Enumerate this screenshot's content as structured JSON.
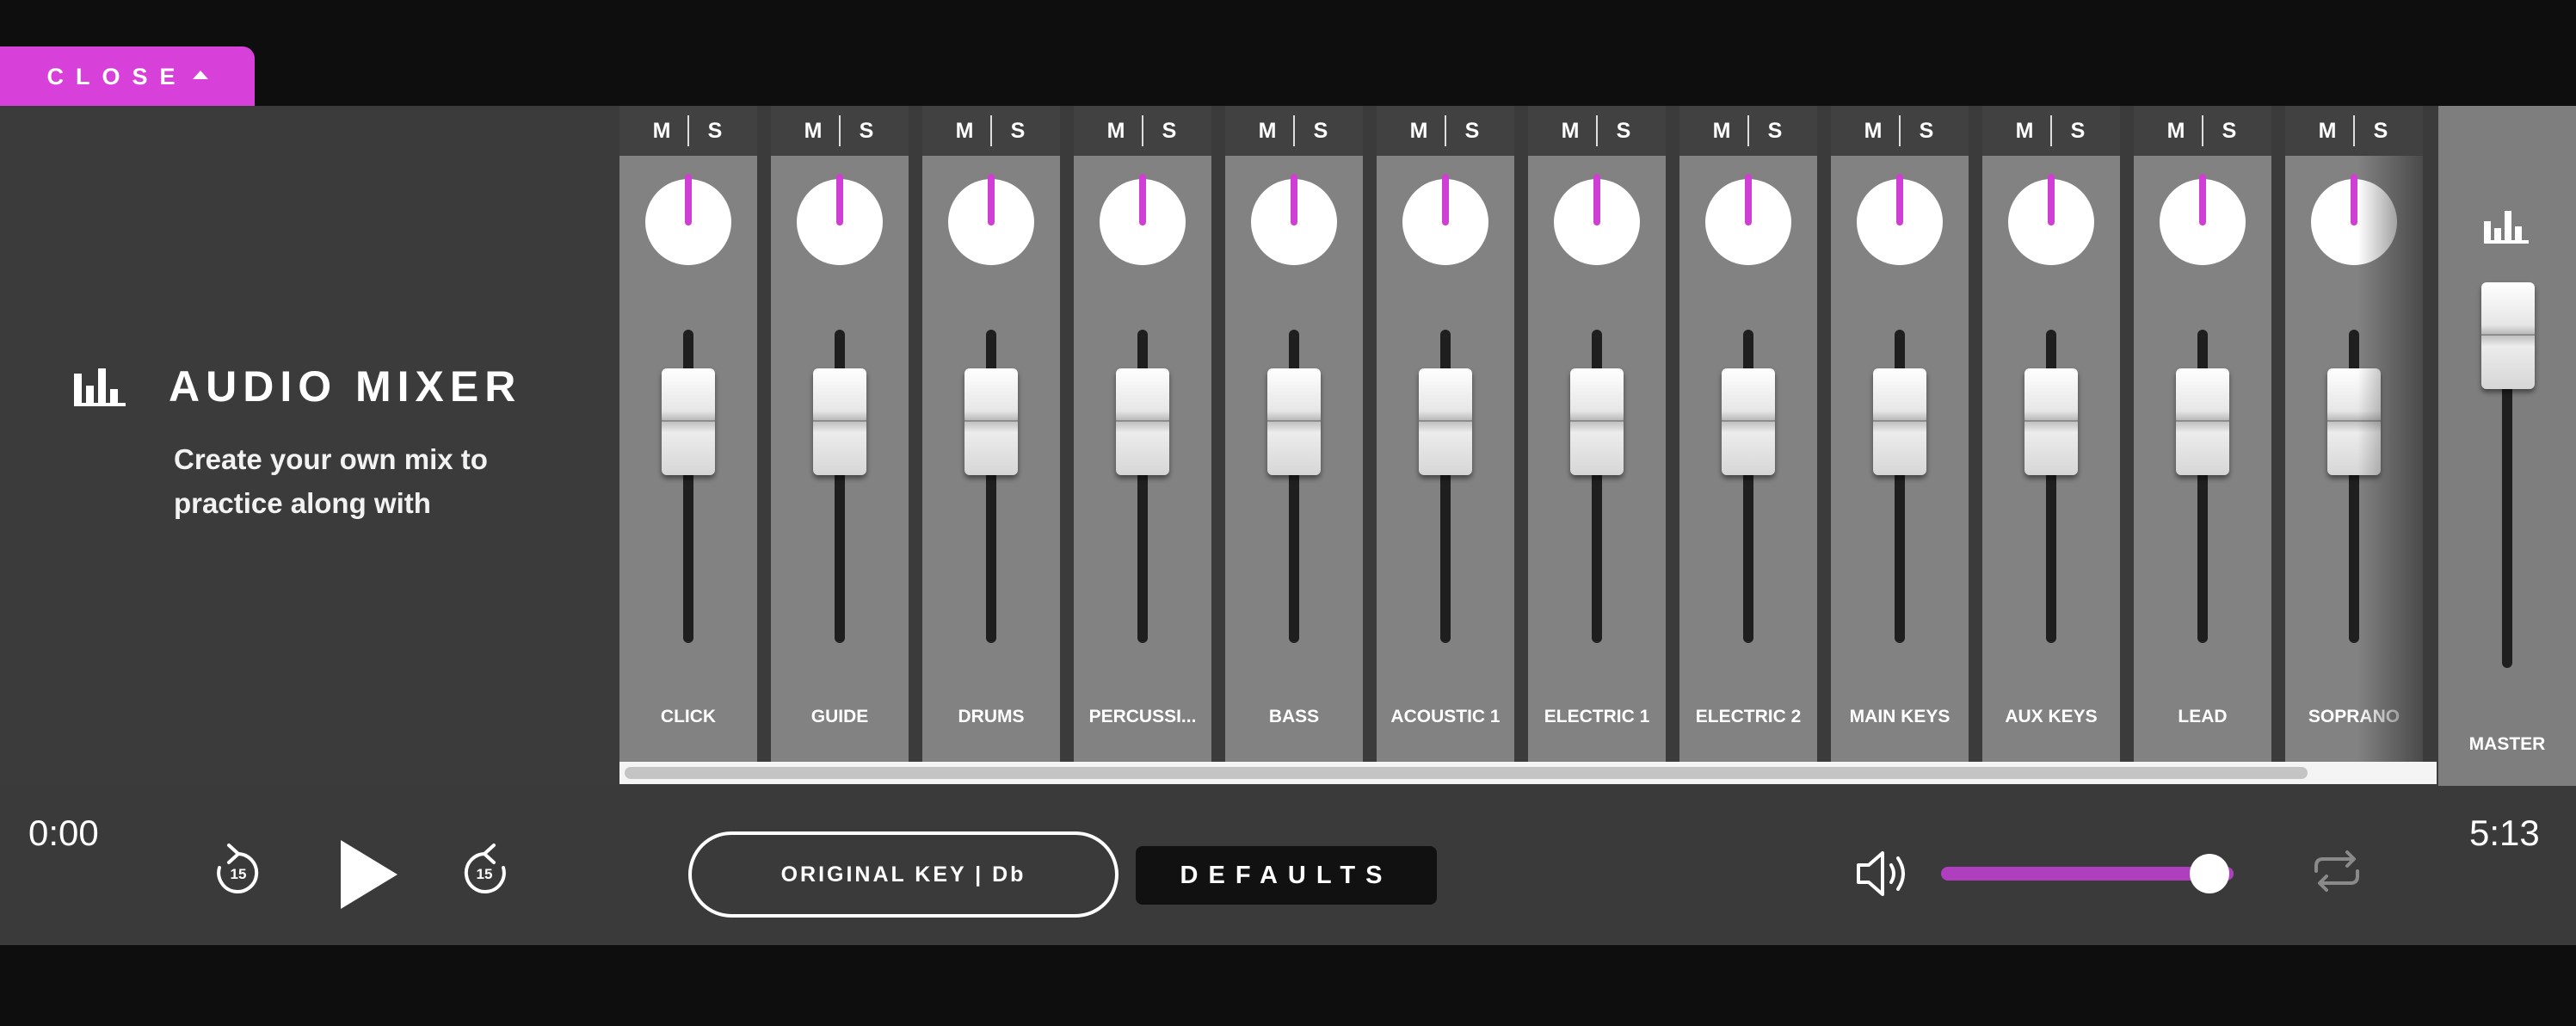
{
  "close_tab": {
    "label": "CLOSE"
  },
  "header": {
    "title": "AUDIO MIXER",
    "subtitle": "Create your own mix to practice along with"
  },
  "channel_controls": {
    "mute": "M",
    "solo": "S"
  },
  "channels": [
    {
      "name": "CLICK"
    },
    {
      "name": "GUIDE"
    },
    {
      "name": "DRUMS"
    },
    {
      "name": "PERCUSSI..."
    },
    {
      "name": "BASS"
    },
    {
      "name": "ACOUSTIC 1"
    },
    {
      "name": "ELECTRIC 1"
    },
    {
      "name": "ELECTRIC 2"
    },
    {
      "name": "MAIN KEYS"
    },
    {
      "name": "AUX KEYS"
    },
    {
      "name": "LEAD"
    },
    {
      "name": "SOPRANO"
    }
  ],
  "master": {
    "label": "MASTER"
  },
  "transport": {
    "time_start": "0:00",
    "time_end": "5:13",
    "skip_back_seconds": "15",
    "skip_forward_seconds": "15",
    "key_button": "ORIGINAL KEY | Db",
    "defaults_button": "DEFAULTS",
    "volume_level": 0.9
  },
  "icons": {
    "close_caret": "caret-up-icon",
    "mixer": "equalizer-bars-icon",
    "rewind": "rewind-15-icon",
    "play": "play-icon",
    "forward": "forward-15-icon",
    "speaker": "speaker-icon",
    "loop": "loop-icon"
  },
  "colors": {
    "accent": "#d741d9",
    "panel": "#3b3b3b",
    "strip": "#828282"
  }
}
